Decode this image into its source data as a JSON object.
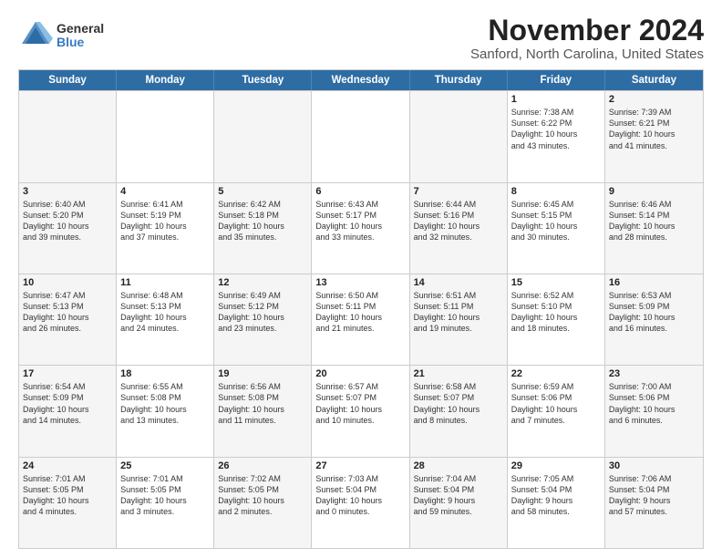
{
  "logo": {
    "general": "General",
    "blue": "Blue"
  },
  "title": "November 2024",
  "subtitle": "Sanford, North Carolina, United States",
  "headers": [
    "Sunday",
    "Monday",
    "Tuesday",
    "Wednesday",
    "Thursday",
    "Friday",
    "Saturday"
  ],
  "weeks": [
    [
      {
        "day": "",
        "info": ""
      },
      {
        "day": "",
        "info": ""
      },
      {
        "day": "",
        "info": ""
      },
      {
        "day": "",
        "info": ""
      },
      {
        "day": "",
        "info": ""
      },
      {
        "day": "1",
        "info": "Sunrise: 7:38 AM\nSunset: 6:22 PM\nDaylight: 10 hours\nand 43 minutes."
      },
      {
        "day": "2",
        "info": "Sunrise: 7:39 AM\nSunset: 6:21 PM\nDaylight: 10 hours\nand 41 minutes."
      }
    ],
    [
      {
        "day": "3",
        "info": "Sunrise: 6:40 AM\nSunset: 5:20 PM\nDaylight: 10 hours\nand 39 minutes."
      },
      {
        "day": "4",
        "info": "Sunrise: 6:41 AM\nSunset: 5:19 PM\nDaylight: 10 hours\nand 37 minutes."
      },
      {
        "day": "5",
        "info": "Sunrise: 6:42 AM\nSunset: 5:18 PM\nDaylight: 10 hours\nand 35 minutes."
      },
      {
        "day": "6",
        "info": "Sunrise: 6:43 AM\nSunset: 5:17 PM\nDaylight: 10 hours\nand 33 minutes."
      },
      {
        "day": "7",
        "info": "Sunrise: 6:44 AM\nSunset: 5:16 PM\nDaylight: 10 hours\nand 32 minutes."
      },
      {
        "day": "8",
        "info": "Sunrise: 6:45 AM\nSunset: 5:15 PM\nDaylight: 10 hours\nand 30 minutes."
      },
      {
        "day": "9",
        "info": "Sunrise: 6:46 AM\nSunset: 5:14 PM\nDaylight: 10 hours\nand 28 minutes."
      }
    ],
    [
      {
        "day": "10",
        "info": "Sunrise: 6:47 AM\nSunset: 5:13 PM\nDaylight: 10 hours\nand 26 minutes."
      },
      {
        "day": "11",
        "info": "Sunrise: 6:48 AM\nSunset: 5:13 PM\nDaylight: 10 hours\nand 24 minutes."
      },
      {
        "day": "12",
        "info": "Sunrise: 6:49 AM\nSunset: 5:12 PM\nDaylight: 10 hours\nand 23 minutes."
      },
      {
        "day": "13",
        "info": "Sunrise: 6:50 AM\nSunset: 5:11 PM\nDaylight: 10 hours\nand 21 minutes."
      },
      {
        "day": "14",
        "info": "Sunrise: 6:51 AM\nSunset: 5:11 PM\nDaylight: 10 hours\nand 19 minutes."
      },
      {
        "day": "15",
        "info": "Sunrise: 6:52 AM\nSunset: 5:10 PM\nDaylight: 10 hours\nand 18 minutes."
      },
      {
        "day": "16",
        "info": "Sunrise: 6:53 AM\nSunset: 5:09 PM\nDaylight: 10 hours\nand 16 minutes."
      }
    ],
    [
      {
        "day": "17",
        "info": "Sunrise: 6:54 AM\nSunset: 5:09 PM\nDaylight: 10 hours\nand 14 minutes."
      },
      {
        "day": "18",
        "info": "Sunrise: 6:55 AM\nSunset: 5:08 PM\nDaylight: 10 hours\nand 13 minutes."
      },
      {
        "day": "19",
        "info": "Sunrise: 6:56 AM\nSunset: 5:08 PM\nDaylight: 10 hours\nand 11 minutes."
      },
      {
        "day": "20",
        "info": "Sunrise: 6:57 AM\nSunset: 5:07 PM\nDaylight: 10 hours\nand 10 minutes."
      },
      {
        "day": "21",
        "info": "Sunrise: 6:58 AM\nSunset: 5:07 PM\nDaylight: 10 hours\nand 8 minutes."
      },
      {
        "day": "22",
        "info": "Sunrise: 6:59 AM\nSunset: 5:06 PM\nDaylight: 10 hours\nand 7 minutes."
      },
      {
        "day": "23",
        "info": "Sunrise: 7:00 AM\nSunset: 5:06 PM\nDaylight: 10 hours\nand 6 minutes."
      }
    ],
    [
      {
        "day": "24",
        "info": "Sunrise: 7:01 AM\nSunset: 5:05 PM\nDaylight: 10 hours\nand 4 minutes."
      },
      {
        "day": "25",
        "info": "Sunrise: 7:01 AM\nSunset: 5:05 PM\nDaylight: 10 hours\nand 3 minutes."
      },
      {
        "day": "26",
        "info": "Sunrise: 7:02 AM\nSunset: 5:05 PM\nDaylight: 10 hours\nand 2 minutes."
      },
      {
        "day": "27",
        "info": "Sunrise: 7:03 AM\nSunset: 5:04 PM\nDaylight: 10 hours\nand 0 minutes."
      },
      {
        "day": "28",
        "info": "Sunrise: 7:04 AM\nSunset: 5:04 PM\nDaylight: 9 hours\nand 59 minutes."
      },
      {
        "day": "29",
        "info": "Sunrise: 7:05 AM\nSunset: 5:04 PM\nDaylight: 9 hours\nand 58 minutes."
      },
      {
        "day": "30",
        "info": "Sunrise: 7:06 AM\nSunset: 5:04 PM\nDaylight: 9 hours\nand 57 minutes."
      }
    ]
  ]
}
